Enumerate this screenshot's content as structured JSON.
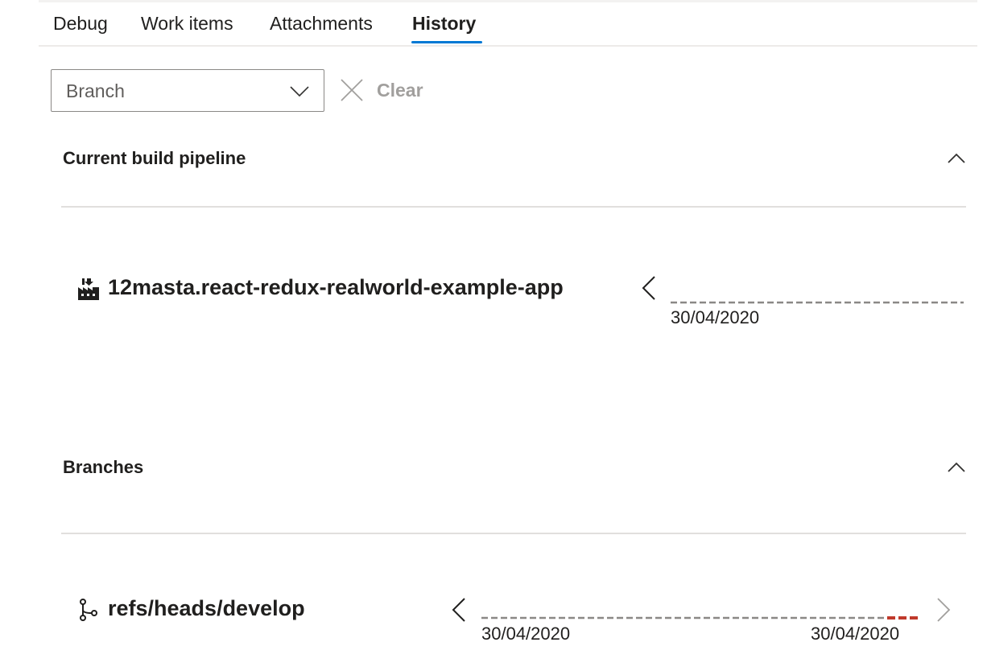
{
  "tabs": [
    {
      "label": "Debug"
    },
    {
      "label": "Work items"
    },
    {
      "label": "Attachments"
    },
    {
      "label": "History",
      "selected": true
    }
  ],
  "filter": {
    "branch_placeholder": "Branch",
    "clear_label": "Clear"
  },
  "sections": {
    "current_pipeline": {
      "title": "Current build pipeline",
      "item": {
        "icon": "pipeline-icon",
        "name": "12masta.react-redux-realworld-example-app",
        "start_date": "30/04/2020"
      }
    },
    "branches": {
      "title": "Branches",
      "item": {
        "icon": "branch-icon",
        "name": "refs/heads/develop",
        "start_date": "30/04/2020",
        "end_date": "30/04/2020"
      }
    }
  },
  "colors": {
    "accent": "#0078d4",
    "timeline": "#8a8886",
    "failed": "#c0392b",
    "text": "#201f1e",
    "muted": "#a19f9d"
  }
}
